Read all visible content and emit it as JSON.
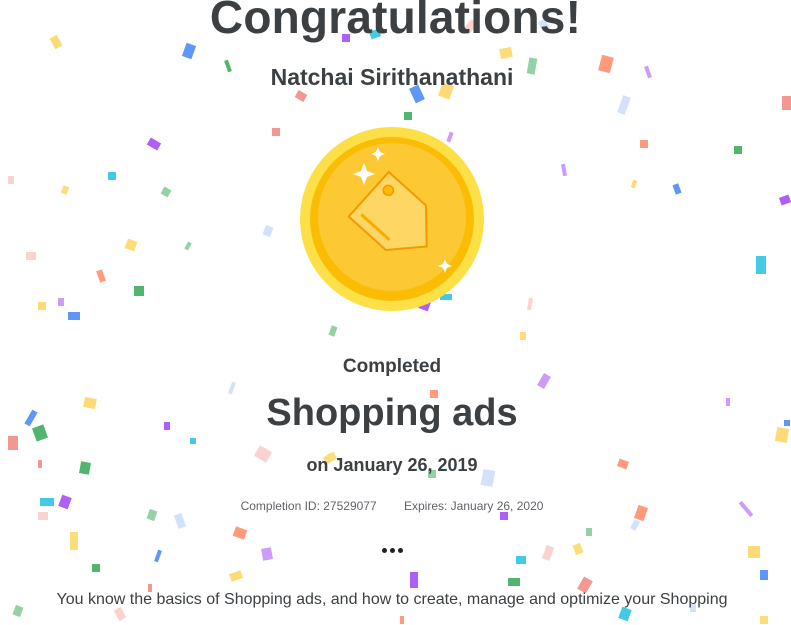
{
  "headline": "Congratulations!",
  "recipient_name": "Natchai Sirithanathani",
  "status_label": "Completed",
  "course_title": "Shopping ads",
  "completion_date": "on January 26, 2019",
  "completion_id": "Completion ID: 27529077",
  "expires": "Expires: January 26, 2020",
  "more_menu_label": "•••",
  "description": "You know the basics of Shopping ads, and how to create, manage and optimize your Shopping",
  "badge": {
    "icon": "price-tag-icon",
    "sparkle_icon": "sparkle-icon"
  },
  "colors": {
    "text": "#3c4043",
    "badge_outer": "#fde047",
    "badge_inner": "#fbbc04",
    "badge_face": "#fcc934"
  }
}
